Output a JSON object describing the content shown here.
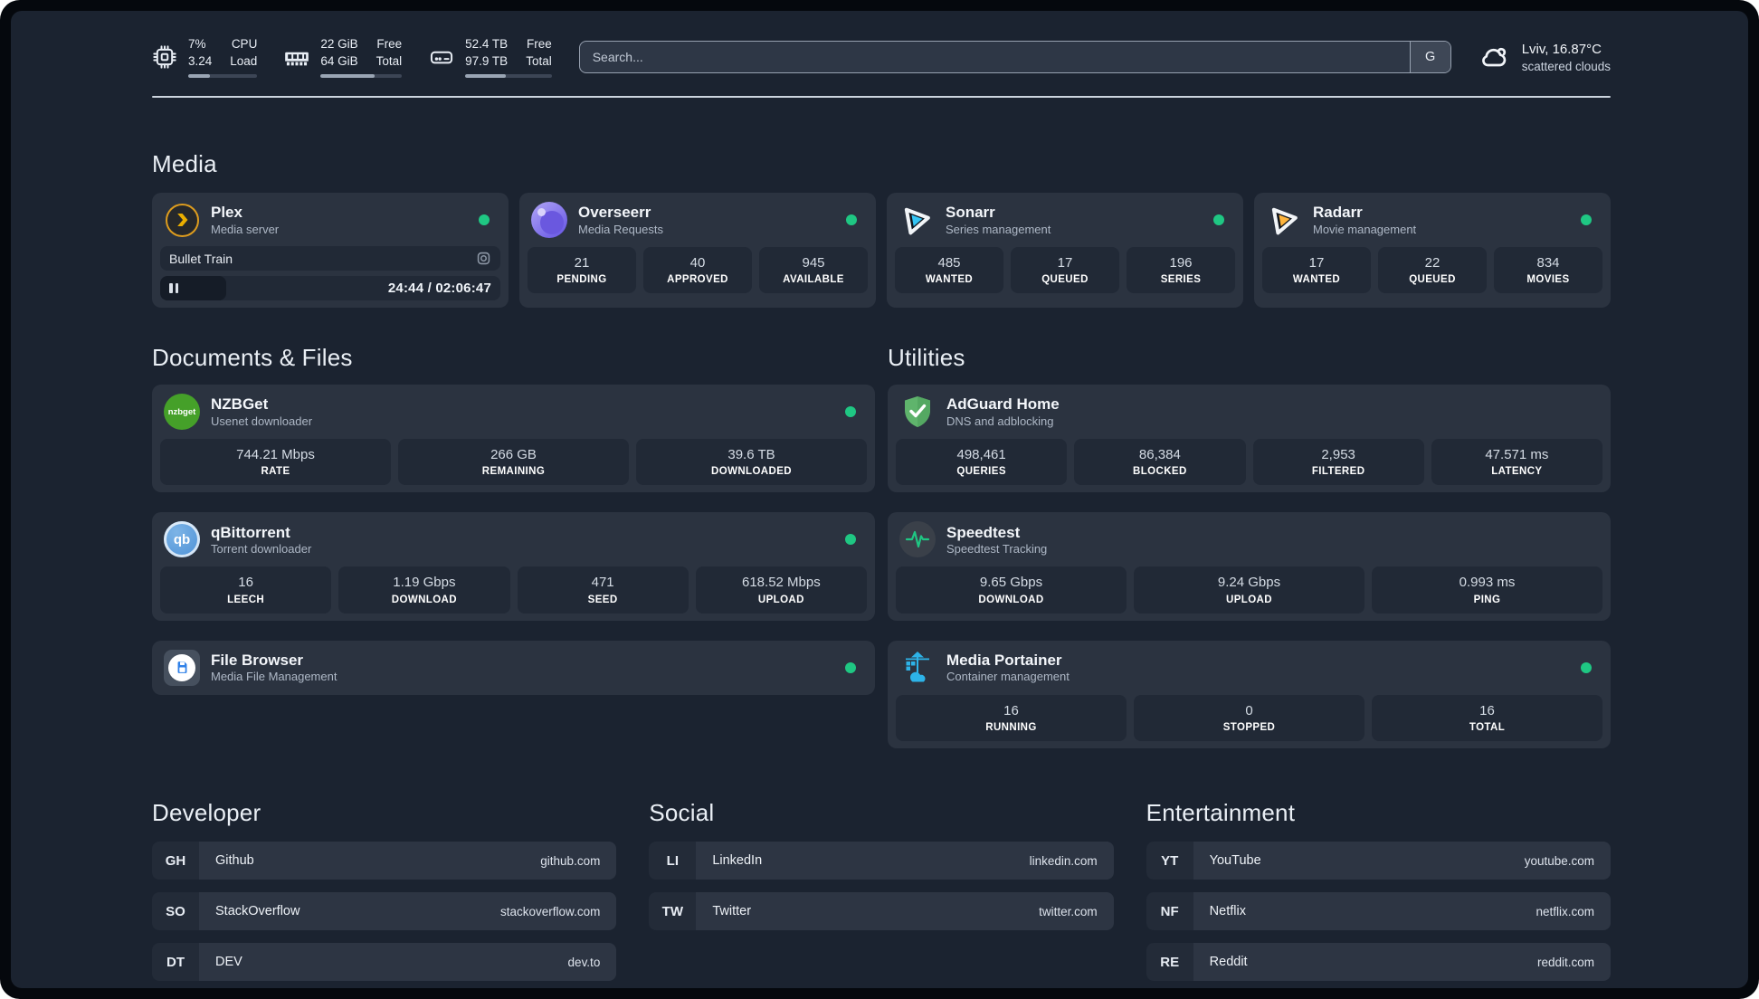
{
  "header": {
    "stats": [
      {
        "id": "cpu",
        "top_left": "7%",
        "bottom_left": "3.24",
        "top_right": "CPU",
        "bottom_right": "Load",
        "progress_pct": 32
      },
      {
        "id": "memory",
        "top_left": "22 GiB",
        "bottom_left": "64 GiB",
        "top_right": "Free",
        "bottom_right": "Total",
        "progress_pct": 66
      },
      {
        "id": "disk",
        "top_left": "52.4 TB",
        "bottom_left": "97.9 TB",
        "top_right": "Free",
        "bottom_right": "Total",
        "progress_pct": 47
      }
    ],
    "search": {
      "placeholder": "Search...",
      "provider_button": "G"
    },
    "weather": {
      "line1": "Lviv, 16.87°C",
      "line2": "scattered clouds"
    }
  },
  "media": {
    "heading": "Media",
    "plex": {
      "name": "Plex",
      "desc": "Media server",
      "now_playing": "Bullet Train",
      "time": "24:44 / 02:06:47",
      "progress_pct": 19.5
    },
    "overseerr": {
      "name": "Overseerr",
      "desc": "Media Requests",
      "stats": [
        {
          "value": "21",
          "label": "PENDING"
        },
        {
          "value": "40",
          "label": "APPROVED"
        },
        {
          "value": "945",
          "label": "AVAILABLE"
        }
      ]
    },
    "sonarr": {
      "name": "Sonarr",
      "desc": "Series management",
      "stats": [
        {
          "value": "485",
          "label": "WANTED"
        },
        {
          "value": "17",
          "label": "QUEUED"
        },
        {
          "value": "196",
          "label": "SERIES"
        }
      ]
    },
    "radarr": {
      "name": "Radarr",
      "desc": "Movie management",
      "stats": [
        {
          "value": "17",
          "label": "WANTED"
        },
        {
          "value": "22",
          "label": "QUEUED"
        },
        {
          "value": "834",
          "label": "MOVIES"
        }
      ]
    }
  },
  "documents": {
    "heading": "Documents & Files",
    "nzbget": {
      "name": "NZBGet",
      "desc": "Usenet downloader",
      "icon_text": "nzbget",
      "stats": [
        {
          "value": "744.21 Mbps",
          "label": "RATE"
        },
        {
          "value": "266 GB",
          "label": "REMAINING"
        },
        {
          "value": "39.6 TB",
          "label": "DOWNLOADED"
        }
      ]
    },
    "qbittorrent": {
      "name": "qBittorrent",
      "desc": "Torrent downloader",
      "icon_text": "qb",
      "stats": [
        {
          "value": "16",
          "label": "LEECH"
        },
        {
          "value": "1.19 Gbps",
          "label": "DOWNLOAD"
        },
        {
          "value": "471",
          "label": "SEED"
        },
        {
          "value": "618.52 Mbps",
          "label": "UPLOAD"
        }
      ]
    },
    "filebrowser": {
      "name": "File Browser",
      "desc": "Media File Management"
    }
  },
  "utilities": {
    "heading": "Utilities",
    "adguard": {
      "name": "AdGuard Home",
      "desc": "DNS and adblocking",
      "stats": [
        {
          "value": "498,461",
          "label": "QUERIES"
        },
        {
          "value": "86,384",
          "label": "BLOCKED"
        },
        {
          "value": "2,953",
          "label": "FILTERED"
        },
        {
          "value": "47.571 ms",
          "label": "LATENCY"
        }
      ]
    },
    "speedtest": {
      "name": "Speedtest",
      "desc": "Speedtest Tracking",
      "stats": [
        {
          "value": "9.65 Gbps",
          "label": "DOWNLOAD"
        },
        {
          "value": "9.24 Gbps",
          "label": "UPLOAD"
        },
        {
          "value": "0.993 ms",
          "label": "PING"
        }
      ]
    },
    "portainer": {
      "name": "Media Portainer",
      "desc": "Container management",
      "stats": [
        {
          "value": "16",
          "label": "RUNNING"
        },
        {
          "value": "0",
          "label": "STOPPED"
        },
        {
          "value": "16",
          "label": "TOTAL"
        }
      ]
    }
  },
  "bookmarks": [
    {
      "heading": "Developer",
      "items": [
        {
          "abbr": "GH",
          "name": "Github",
          "url": "github.com"
        },
        {
          "abbr": "SO",
          "name": "StackOverflow",
          "url": "stackoverflow.com"
        },
        {
          "abbr": "DT",
          "name": "DEV",
          "url": "dev.to"
        }
      ]
    },
    {
      "heading": "Social",
      "items": [
        {
          "abbr": "LI",
          "name": "LinkedIn",
          "url": "linkedin.com"
        },
        {
          "abbr": "TW",
          "name": "Twitter",
          "url": "twitter.com"
        }
      ]
    },
    {
      "heading": "Entertainment",
      "items": [
        {
          "abbr": "YT",
          "name": "YouTube",
          "url": "youtube.com"
        },
        {
          "abbr": "NF",
          "name": "Netflix",
          "url": "netflix.com"
        },
        {
          "abbr": "RE",
          "name": "Reddit",
          "url": "reddit.com"
        }
      ]
    }
  ],
  "colors": {
    "online": "#1fc783",
    "page_bg": "#1b2330",
    "card_bg": "#2b3340"
  }
}
